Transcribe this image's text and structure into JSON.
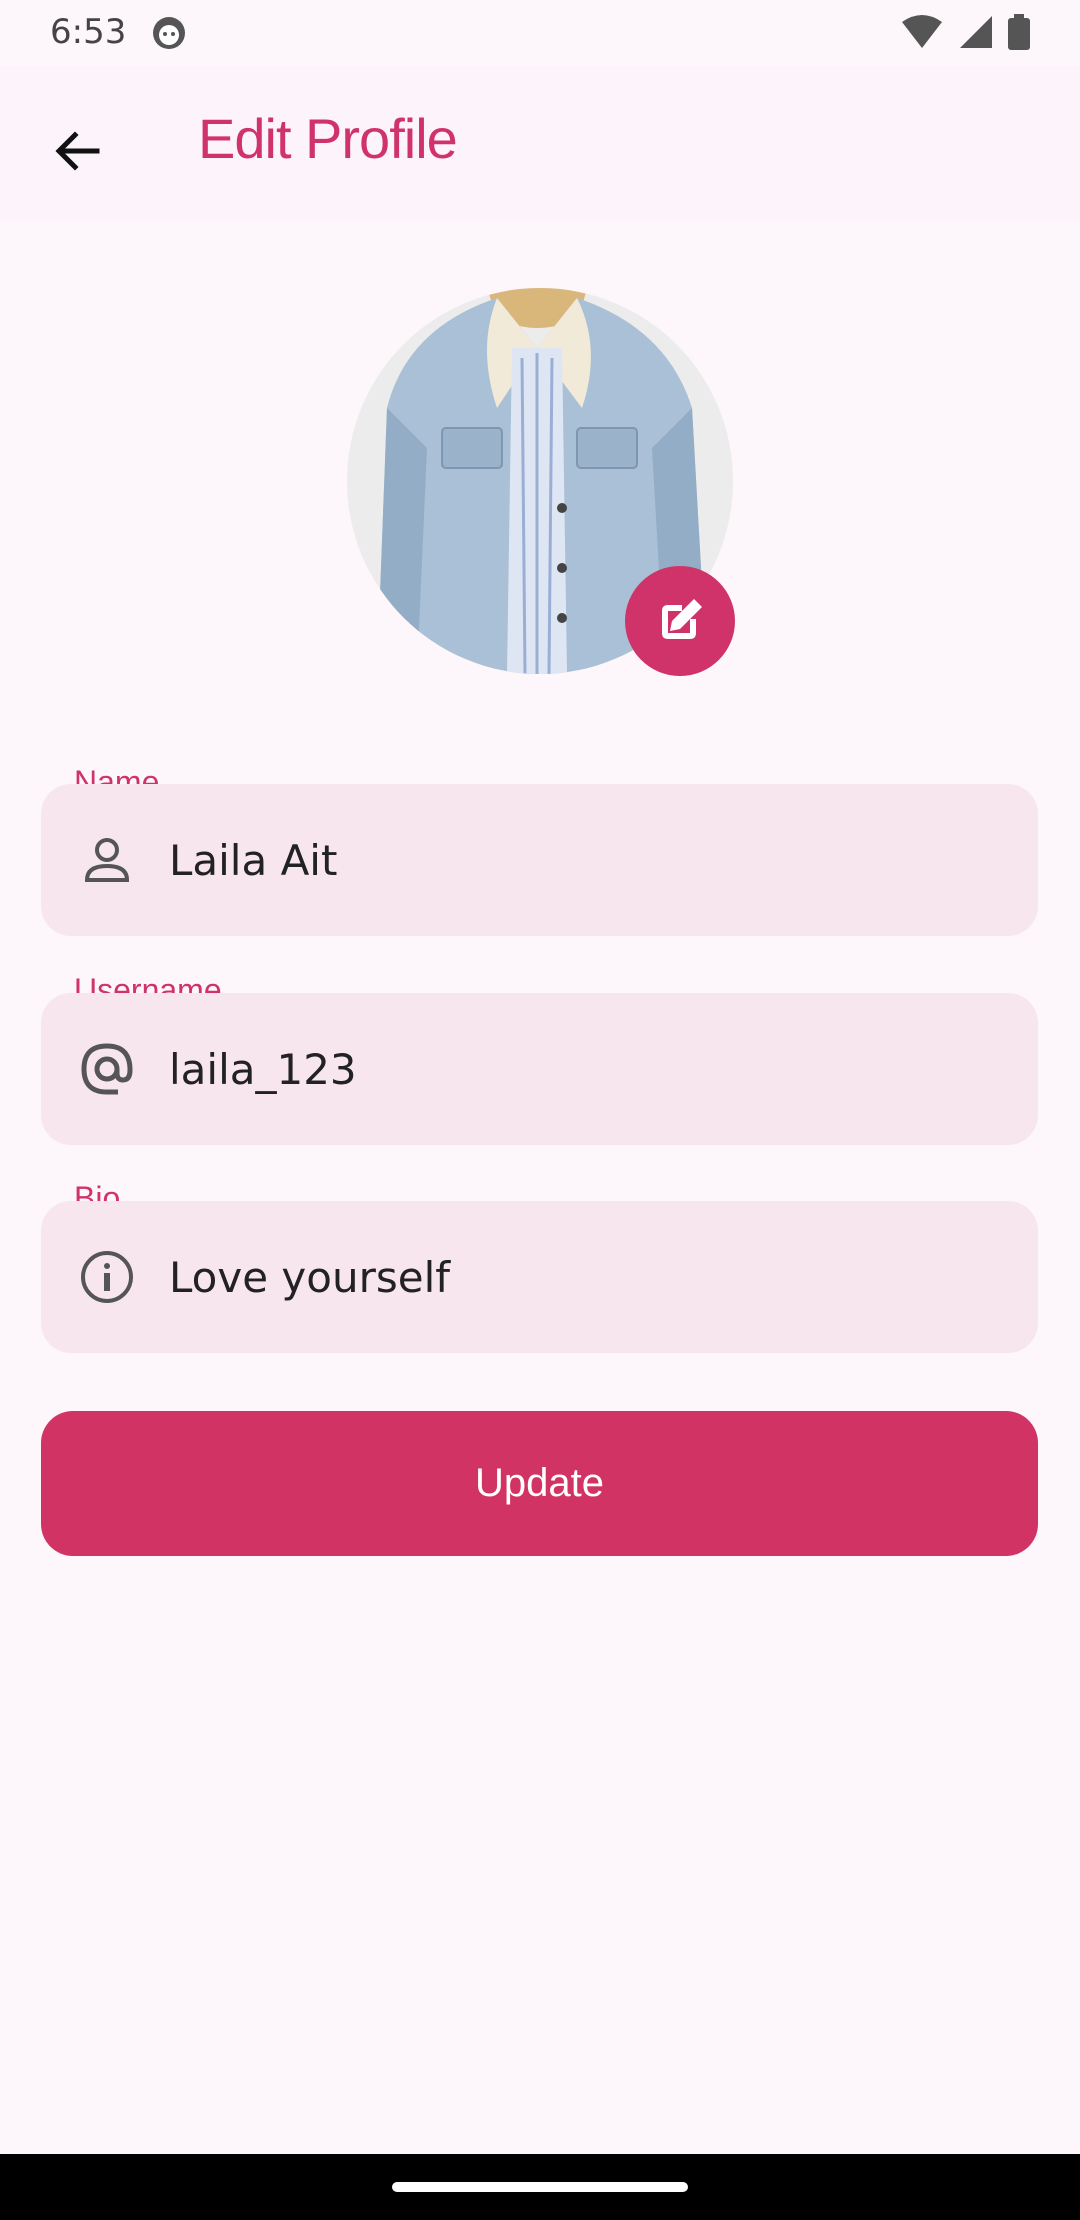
{
  "status": {
    "time": "6:53"
  },
  "header": {
    "title": "Edit Profile"
  },
  "fields": [
    {
      "label": "Name",
      "value": "Laila Ait",
      "icon": "person-icon"
    },
    {
      "label": "Username",
      "value": "laila_123",
      "icon": "at-icon"
    },
    {
      "label": "Bio",
      "value": "Love yourself",
      "icon": "info-icon"
    }
  ],
  "actions": {
    "update_label": "Update"
  },
  "colors": {
    "accent": "#d0336a",
    "field_bg": "#f8e6ef",
    "background": "#fdf6fb"
  }
}
